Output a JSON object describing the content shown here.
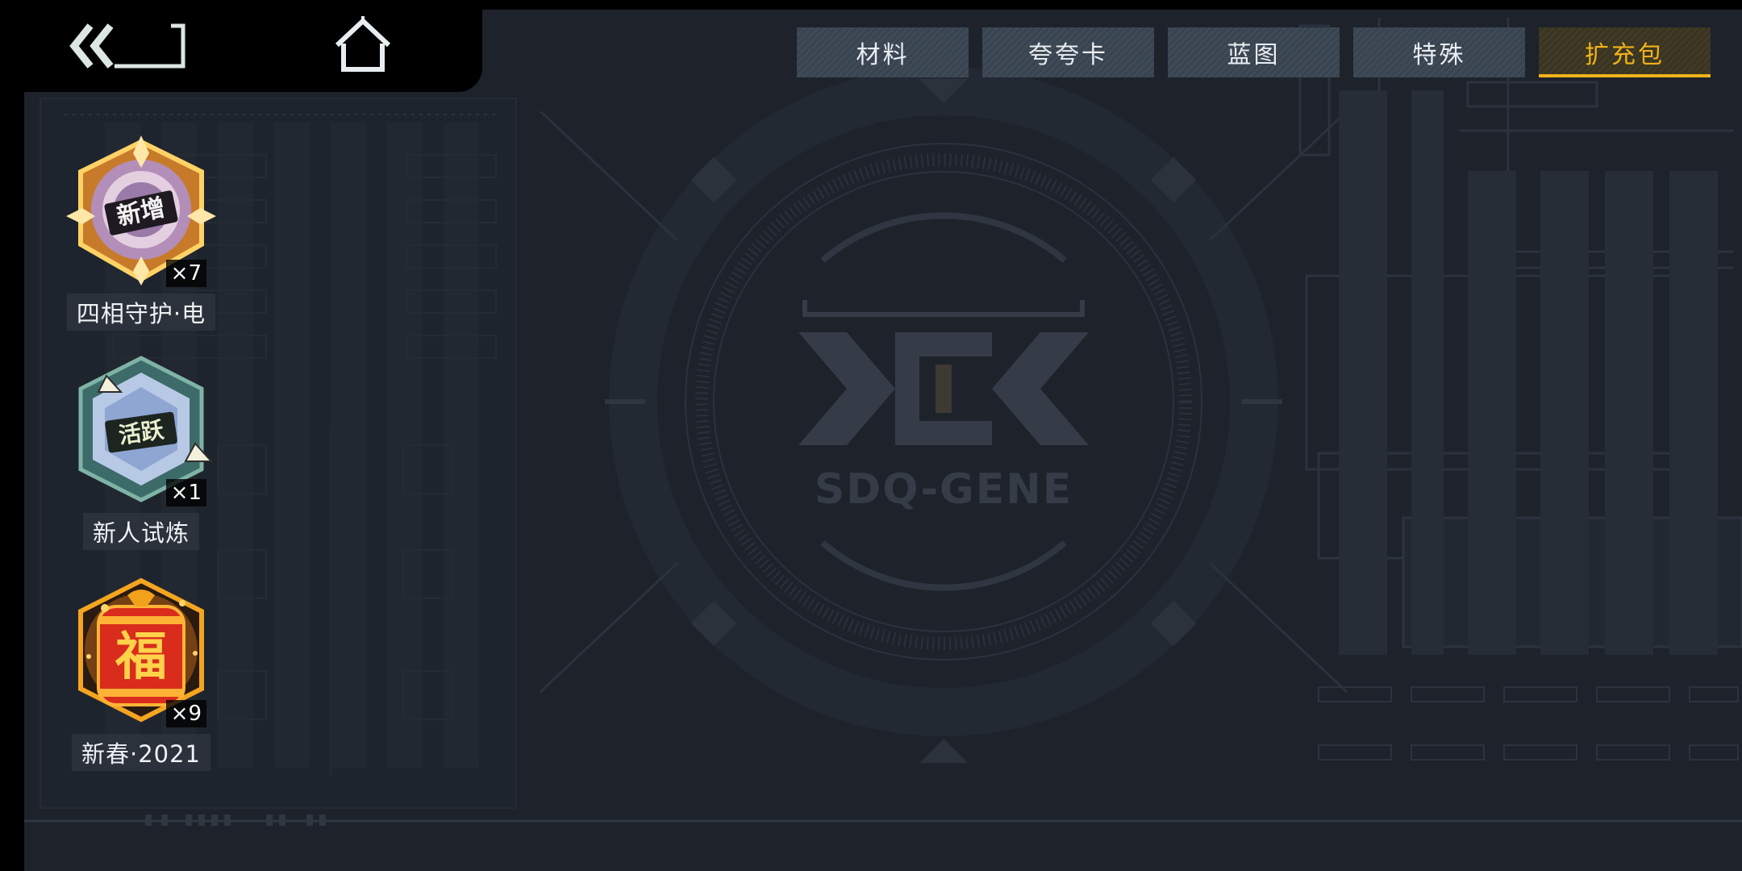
{
  "nav": {
    "back_icon": "double-chevron-left-icon",
    "home_icon": "home-icon"
  },
  "tabs": [
    {
      "label": "材料",
      "active": false
    },
    {
      "label": "夸夸卡",
      "active": false
    },
    {
      "label": "蓝图",
      "active": false
    },
    {
      "label": "特殊",
      "active": false
    },
    {
      "label": "扩充包",
      "active": true
    }
  ],
  "items": [
    {
      "name": "四相守护·电",
      "count": "×7",
      "badge_text": "新增",
      "icon": "hexagon-badge-icon"
    },
    {
      "name": "新人试炼",
      "count": "×1",
      "badge_text": "活跃",
      "icon": "hexagon-badge-icon"
    },
    {
      "name": "新春·2021",
      "count": "×9",
      "badge_text": "福",
      "icon": "lucky-jar-icon"
    }
  ],
  "background": {
    "logo_text": "SDQ-GENE",
    "logo_icon": "xdx-logo-icon"
  },
  "colors": {
    "accent": "#f3b21a",
    "background": "#1d222b",
    "tab": "#3c4652"
  }
}
